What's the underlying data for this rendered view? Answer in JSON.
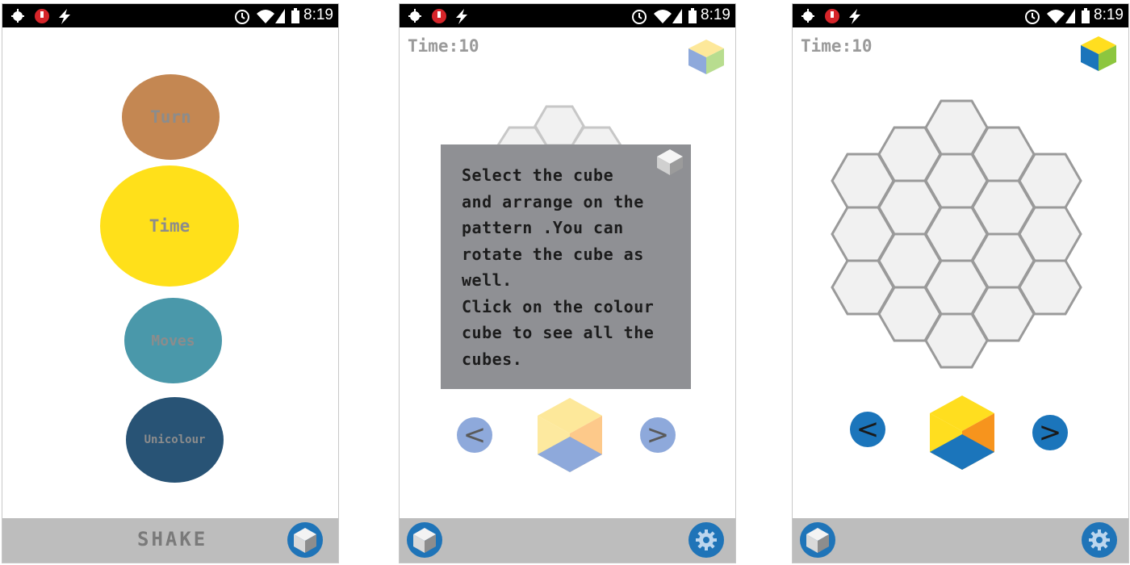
{
  "status_bar": {
    "time": "8:19"
  },
  "screen1": {
    "menu": [
      {
        "label": "Turn",
        "color": "#c48752",
        "text_color": "#8c8c8c"
      },
      {
        "label": "Time",
        "color": "#ffe01a",
        "text_color": "#8c8c8c"
      },
      {
        "label": "Moves",
        "color": "#4a98aa",
        "text_color": "#8c8c8c"
      },
      {
        "label": "Unicolour",
        "color": "#285375",
        "text_color": "#8c8c8c"
      }
    ],
    "bottom_label": "SHAKE"
  },
  "screen2": {
    "timer": "Time:10",
    "help_text": "Select the cube\nand arrange on the\npattern .You can\nrotate the cube as\nwell.\nClick on the colour\ncube to see all the\ncubes.",
    "prev_symbol": "<",
    "next_symbol": ">"
  },
  "screen3": {
    "timer": "Time:10",
    "prev_symbol": "<",
    "next_symbol": ">"
  },
  "colors": {
    "accent_blue": "#1f74b8",
    "cube_yellow": "#ffde1f",
    "cube_orange": "#f7941d",
    "cube_blue": "#1b75bb",
    "cube_green": "#8dc63f",
    "hex_fill": "#f1f1f1",
    "hex_stroke": "#9a9a9a"
  },
  "icons": [
    "android-debug-icon",
    "record-icon",
    "flash-icon",
    "alarm-icon",
    "wifi-icon",
    "signal-icon",
    "battery-icon",
    "cube-icon",
    "gear-icon"
  ]
}
